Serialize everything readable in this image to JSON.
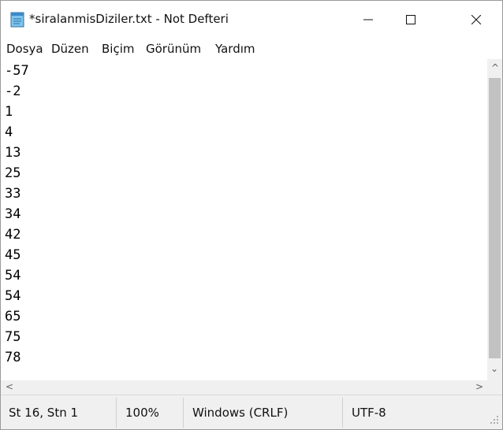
{
  "window": {
    "title": "*siralanmisDiziler.txt - Not Defteri",
    "controls": {
      "minimize": "—",
      "maximize": "☐",
      "close": "✕"
    }
  },
  "menu": {
    "items": [
      {
        "label": "Dosya"
      },
      {
        "label": "Düzen"
      },
      {
        "label": "Biçim"
      },
      {
        "label": "Görünüm"
      },
      {
        "label": "Yardım"
      }
    ]
  },
  "editor": {
    "lines": [
      "-57",
      "-2",
      "1",
      "4",
      "13",
      "25",
      "33",
      "34",
      "42",
      "45",
      "54",
      "54",
      "65",
      "75",
      "78"
    ]
  },
  "scrollbar": {
    "up": "^",
    "down": "⌄",
    "left": "<",
    "right": ">"
  },
  "status": {
    "position": "St 16, Stn 1",
    "zoom": "100%",
    "line_ending": "Windows (CRLF)",
    "encoding": "UTF-8"
  },
  "icons": {
    "app": "notepad-icon",
    "grip": "resize-grip-icon"
  },
  "colors": {
    "thumb": "#c2c2c2",
    "status_bg": "#f0f0f0"
  }
}
